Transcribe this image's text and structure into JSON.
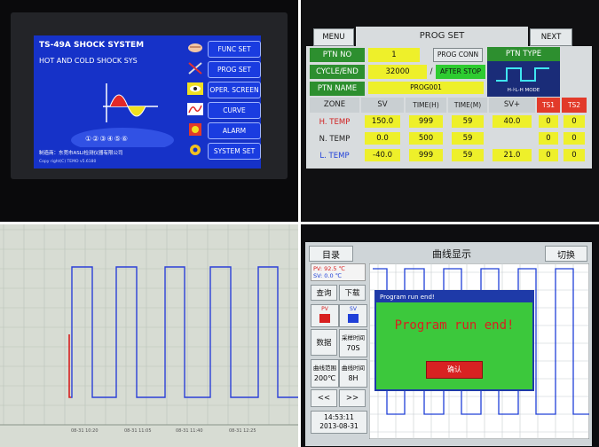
{
  "panel1": {
    "title": "TS-49A  SHOCK SYSTEM",
    "subtitle": "HOT AND COLD SHOCK SYS",
    "menu": [
      "FUNC SET",
      "PROG SET",
      "OPER. SCREEN",
      "CURVE",
      "ALARM",
      "SYSTEM SET"
    ],
    "numbers": "①②③④⑤⑥",
    "maker": "制造商：东莞市ASLI检测仪器有限公司",
    "copyright": "Copy right(C) TEMO v5.6180",
    "colors": {
      "screen": "#1632c8",
      "button": "#1a3ce0"
    }
  },
  "panel2": {
    "menu_label": "MENU",
    "title": "PROG SET",
    "next_label": "NEXT",
    "ptn_no_label": "PTN NO",
    "ptn_no_value": "1",
    "prog_conn_label": "PROG CONN",
    "cycle_label": "CYCLE/END",
    "cycle_value": "32000",
    "slash": "/",
    "after_stop_label": "AFTER STOP",
    "ptn_type_label": "PTN TYPE",
    "ptn_mode": "H-ﾄL-H MODE",
    "ptn_name_label": "PTN NAME",
    "ptn_name_value": "PROG001",
    "table": {
      "headers": [
        "ZONE",
        "SV",
        "TIME(H)",
        "TIME(M)",
        "SV+",
        "TS1",
        "TS2"
      ],
      "rows": [
        {
          "zone": "H. TEMP",
          "sv": "150.0",
          "time_h": "999",
          "time_m": "59",
          "sv_plus": "40.0",
          "ts1": "0",
          "ts2": "0"
        },
        {
          "zone": "N. TEMP",
          "sv": "0.0",
          "time_h": "500",
          "time_m": "59",
          "sv_plus": "",
          "ts1": "0",
          "ts2": "0"
        },
        {
          "zone": "L. TEMP",
          "sv": "-40.0",
          "time_h": "999",
          "time_m": "59",
          "sv_plus": "21.0",
          "ts1": "0",
          "ts2": "0"
        }
      ]
    },
    "colors": {
      "label": "#2d8f2f",
      "value": "#eef02a",
      "ts_header": "#e23a2a"
    }
  },
  "panel3": {
    "time_labels": [
      "08-31 10:20",
      "08-31 11:05",
      "08-31 11:40",
      "08-31 12:25"
    ],
    "colors": {
      "signal": "#2b3fd8",
      "start": "#d62020",
      "grid": "#b9c2ba"
    }
  },
  "panel4": {
    "menu_label": "目录",
    "title": "曲线显示",
    "switch_label": "切换",
    "pv_line": "PV:  92.5  ℃",
    "sv_line": "SV:   0.0  ℃",
    "query_label": "查询",
    "download_label": "下载",
    "pv_label": "PV",
    "sv_label": "SV",
    "data_label": "数据",
    "sample_time_label": "采样时间",
    "sample_time_value": "70S",
    "range_label": "曲线范围",
    "range_value": "200℃",
    "curve_time_label": "曲线时间",
    "curve_time_value": "8H",
    "prev_label": "<<",
    "next_label": ">>",
    "clock_time": "14:53:11",
    "clock_date": "2013-08-31",
    "dialog_title": "Program run end!",
    "dialog_message": "Program run end!",
    "dialog_ok": "确认",
    "colors": {
      "dialog_bg": "#3cc83c",
      "dialog_title_bar": "#1e3aa8",
      "ok_button": "#d82222",
      "pv": "#d82020",
      "sv": "#2040d8"
    }
  }
}
